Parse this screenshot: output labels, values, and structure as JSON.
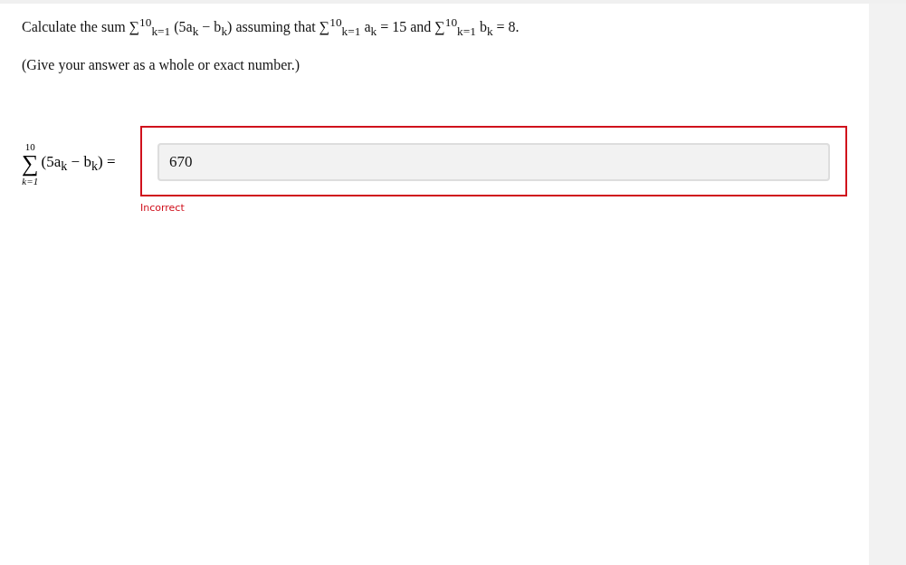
{
  "question": {
    "text": "Calculate the sum ∑$^{10}$$_{k=1}$ (5a$_{k}$ − b$_{k}$) assuming that ∑$^{10}$$_{k=1}$ a$_{k}$ = 15 and ∑$^{10}$$_{k=1}$ b$_{k}$ = 8.",
    "instruction": "(Give your answer as a whole or exact number.)"
  },
  "answer": {
    "upper": "10",
    "symbol": "∑",
    "lower": "k=1",
    "expression": "(5a$_{k}$ − b$_{k}$) =",
    "value": "670",
    "correct": false,
    "feedback": "Incorrect"
  }
}
